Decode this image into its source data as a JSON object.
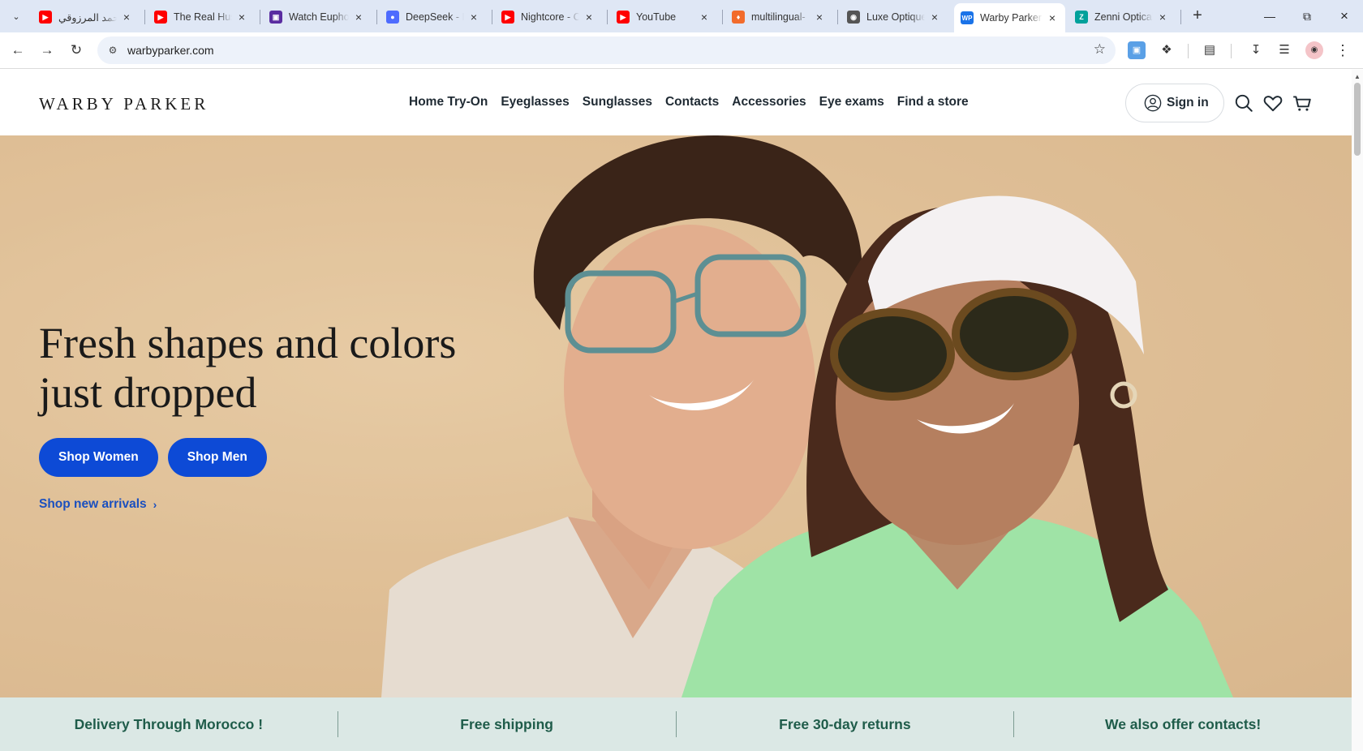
{
  "browser": {
    "tabs": [
      {
        "title": "أحمد المرزوقي",
        "favicon": "youtube-icon",
        "favicon_color": "#ff0000"
      },
      {
        "title": "The Real Hustle",
        "favicon": "youtube-icon",
        "favicon_color": "#ff0000"
      },
      {
        "title": "Watch Euphoria",
        "favicon": "film-icon",
        "favicon_color": "#5a2ca0"
      },
      {
        "title": "DeepSeek - Into",
        "favicon": "deepseek-icon",
        "favicon_color": "#4d6bfe"
      },
      {
        "title": "Nightcore - C",
        "favicon": "youtube-icon",
        "favicon_color": "#ff0000"
      },
      {
        "title": "YouTube",
        "favicon": "youtube-icon",
        "favicon_color": "#ff0000"
      },
      {
        "title": "multilingual-",
        "favicon": "hf-icon",
        "favicon_color": "#f26b2b"
      },
      {
        "title": "Luxe Optique",
        "favicon": "globe-icon",
        "favicon_color": "#555555"
      },
      {
        "title": "Warby Parker",
        "favicon": "wp-icon",
        "favicon_color": "#1a73e8",
        "active": true
      },
      {
        "title": "Zenni Optical",
        "favicon": "zenni-icon",
        "favicon_color": "#00a19b"
      }
    ],
    "url": "warbyparker.com"
  },
  "site": {
    "logo": "WARBY PARKER",
    "nav": [
      "Home Try-On",
      "Eyeglasses",
      "Sunglasses",
      "Contacts",
      "Accessories",
      "Eye exams",
      "Find a store"
    ],
    "sign_in": "Sign in"
  },
  "hero": {
    "headline_line1": "Fresh shapes and colors",
    "headline_line2": "just dropped",
    "shop_women": "Shop Women",
    "shop_men": "Shop Men",
    "new_arrivals": "Shop new arrivals",
    "accent_color": "#0d4ad6"
  },
  "value_props": [
    "Delivery Through Morocco !",
    "Free shipping",
    "Free 30-day returns",
    "We also offer contacts!"
  ]
}
